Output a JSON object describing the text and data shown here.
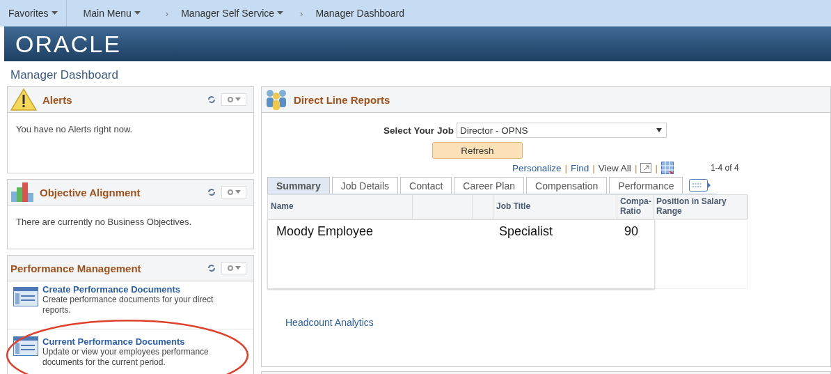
{
  "nav": {
    "items": [
      {
        "label": "Favorites",
        "kind": "menu"
      },
      {
        "label": "Main Menu",
        "kind": "menu"
      },
      {
        "label": "Manager Self Service",
        "kind": "menu",
        "prefix": "›"
      },
      {
        "label": "Manager Dashboard",
        "kind": "crumb",
        "prefix": "›"
      }
    ]
  },
  "banner": {
    "logo": "ORACLE"
  },
  "page_title": "Manager Dashboard",
  "left_pagelets": [
    {
      "title": "Alerts",
      "kind": "alerts",
      "message": "You have no Alerts right now."
    },
    {
      "title": "Objective Alignment",
      "kind": "objectives",
      "message": "There are currently no Business Objectives."
    },
    {
      "title": "Performance Management",
      "kind": "links",
      "links": [
        {
          "title": "Create Performance Documents",
          "description": "Create performance documents for your direct reports.",
          "highlighted": false
        },
        {
          "title": "Current Performance Documents",
          "description": "Update or view your employees performance documents for the current period.",
          "highlighted": true
        }
      ]
    }
  ],
  "direct_reports": {
    "title": "Direct Line Reports",
    "job_label": "Select Your Job",
    "job_value": "Director - OPNS",
    "refresh": "Refresh",
    "grid_links": [
      "Personalize",
      "Find",
      "View All"
    ],
    "separator": "|",
    "count": "1-4 of 4",
    "tabs": [
      {
        "label": "Summary",
        "selected": true
      },
      {
        "label": "Job Details",
        "selected": false
      },
      {
        "label": "Contact",
        "selected": false
      },
      {
        "label": "Career Plan",
        "selected": false
      },
      {
        "label": "Compensation",
        "selected": false
      },
      {
        "label": "Performance",
        "selected": false
      }
    ],
    "columns": [
      "Name",
      "Job Title",
      "Compa-Ratio",
      "Position in Salary Range"
    ],
    "rows": [
      {
        "name": "Moody Employee",
        "job_title": "Specialist",
        "compa_ratio": "90"
      }
    ],
    "footer_link": "Headcount Analytics"
  }
}
